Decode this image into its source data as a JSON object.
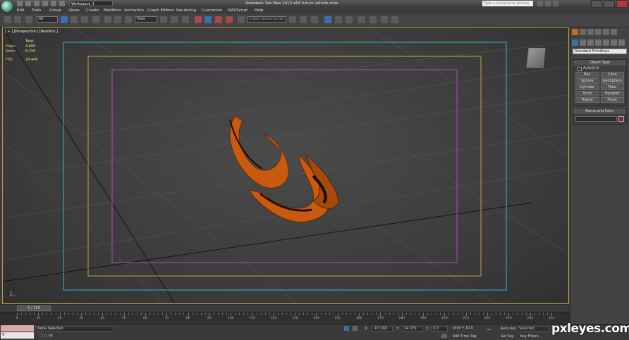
{
  "titlebar": {
    "workspace": "Workspace_1",
    "app_title": "Autodesk 3ds Max  2013 x64      future vehicle.max",
    "search_placeholder": "Type a keyword or phrase"
  },
  "menu": {
    "items": [
      "Edit",
      "Tools",
      "Group",
      "Views",
      "Create",
      "Modifiers",
      "Animation",
      "Graph Editors",
      "Rendering",
      "Customize",
      "MAXScript",
      "Help"
    ]
  },
  "toolbar": {
    "selection_filter": "All",
    "ref_coord": "View",
    "named_selection": "Create Selection Se"
  },
  "viewport": {
    "label": "[ + ] [Perspective ] [Realistic ]",
    "stats": {
      "header": "Total",
      "polys_label": "Polys:",
      "polys_value": "4,899",
      "verts_label": "Verts:",
      "verts_value": "6,156",
      "fps_label": "FPS:",
      "fps_value": "24.448"
    },
    "safe_frame_colors": [
      "#33b7c4",
      "#c9a23a",
      "#b847b8"
    ],
    "object_color": "#c85a10"
  },
  "timeline": {
    "slider_label": "0 / 150",
    "ticks": [
      "0",
      "10",
      "20",
      "30",
      "40",
      "50",
      "60",
      "70",
      "80",
      "90",
      "100",
      "110",
      "120",
      "130",
      "140",
      "150",
      "160",
      "170",
      "180",
      "190",
      "200",
      "210",
      "220",
      "230",
      "240",
      "250"
    ]
  },
  "status": {
    "maxscript": "V",
    "maxscript2": "Va",
    "none_selected": "None Selected",
    "x_label": "X:",
    "x_value": "-63.369",
    "y_label": "Y:",
    "y_value": "24.079",
    "z_label": "Z:",
    "z_value": "0.0",
    "grid": "Grid = 10.0",
    "add_time_tag": "Add Time Tag",
    "auto_key": "Auto Key",
    "selected": "Selected",
    "set_key": "Set Key",
    "key_filters": "Key Filters..."
  },
  "command_panel": {
    "category": "Standard Primitives",
    "object_type_title": "Object Type",
    "autogrid": "AutoGrid",
    "buttons": [
      "Box",
      "Cone",
      "Sphere",
      "GeoSphere",
      "Cylinder",
      "Tube",
      "Torus",
      "Pyramid",
      "Teapot",
      "Plane"
    ],
    "name_color_title": "Name and Color",
    "swatch_color": "#8f1e3a"
  },
  "watermark": "pxleyes.com"
}
